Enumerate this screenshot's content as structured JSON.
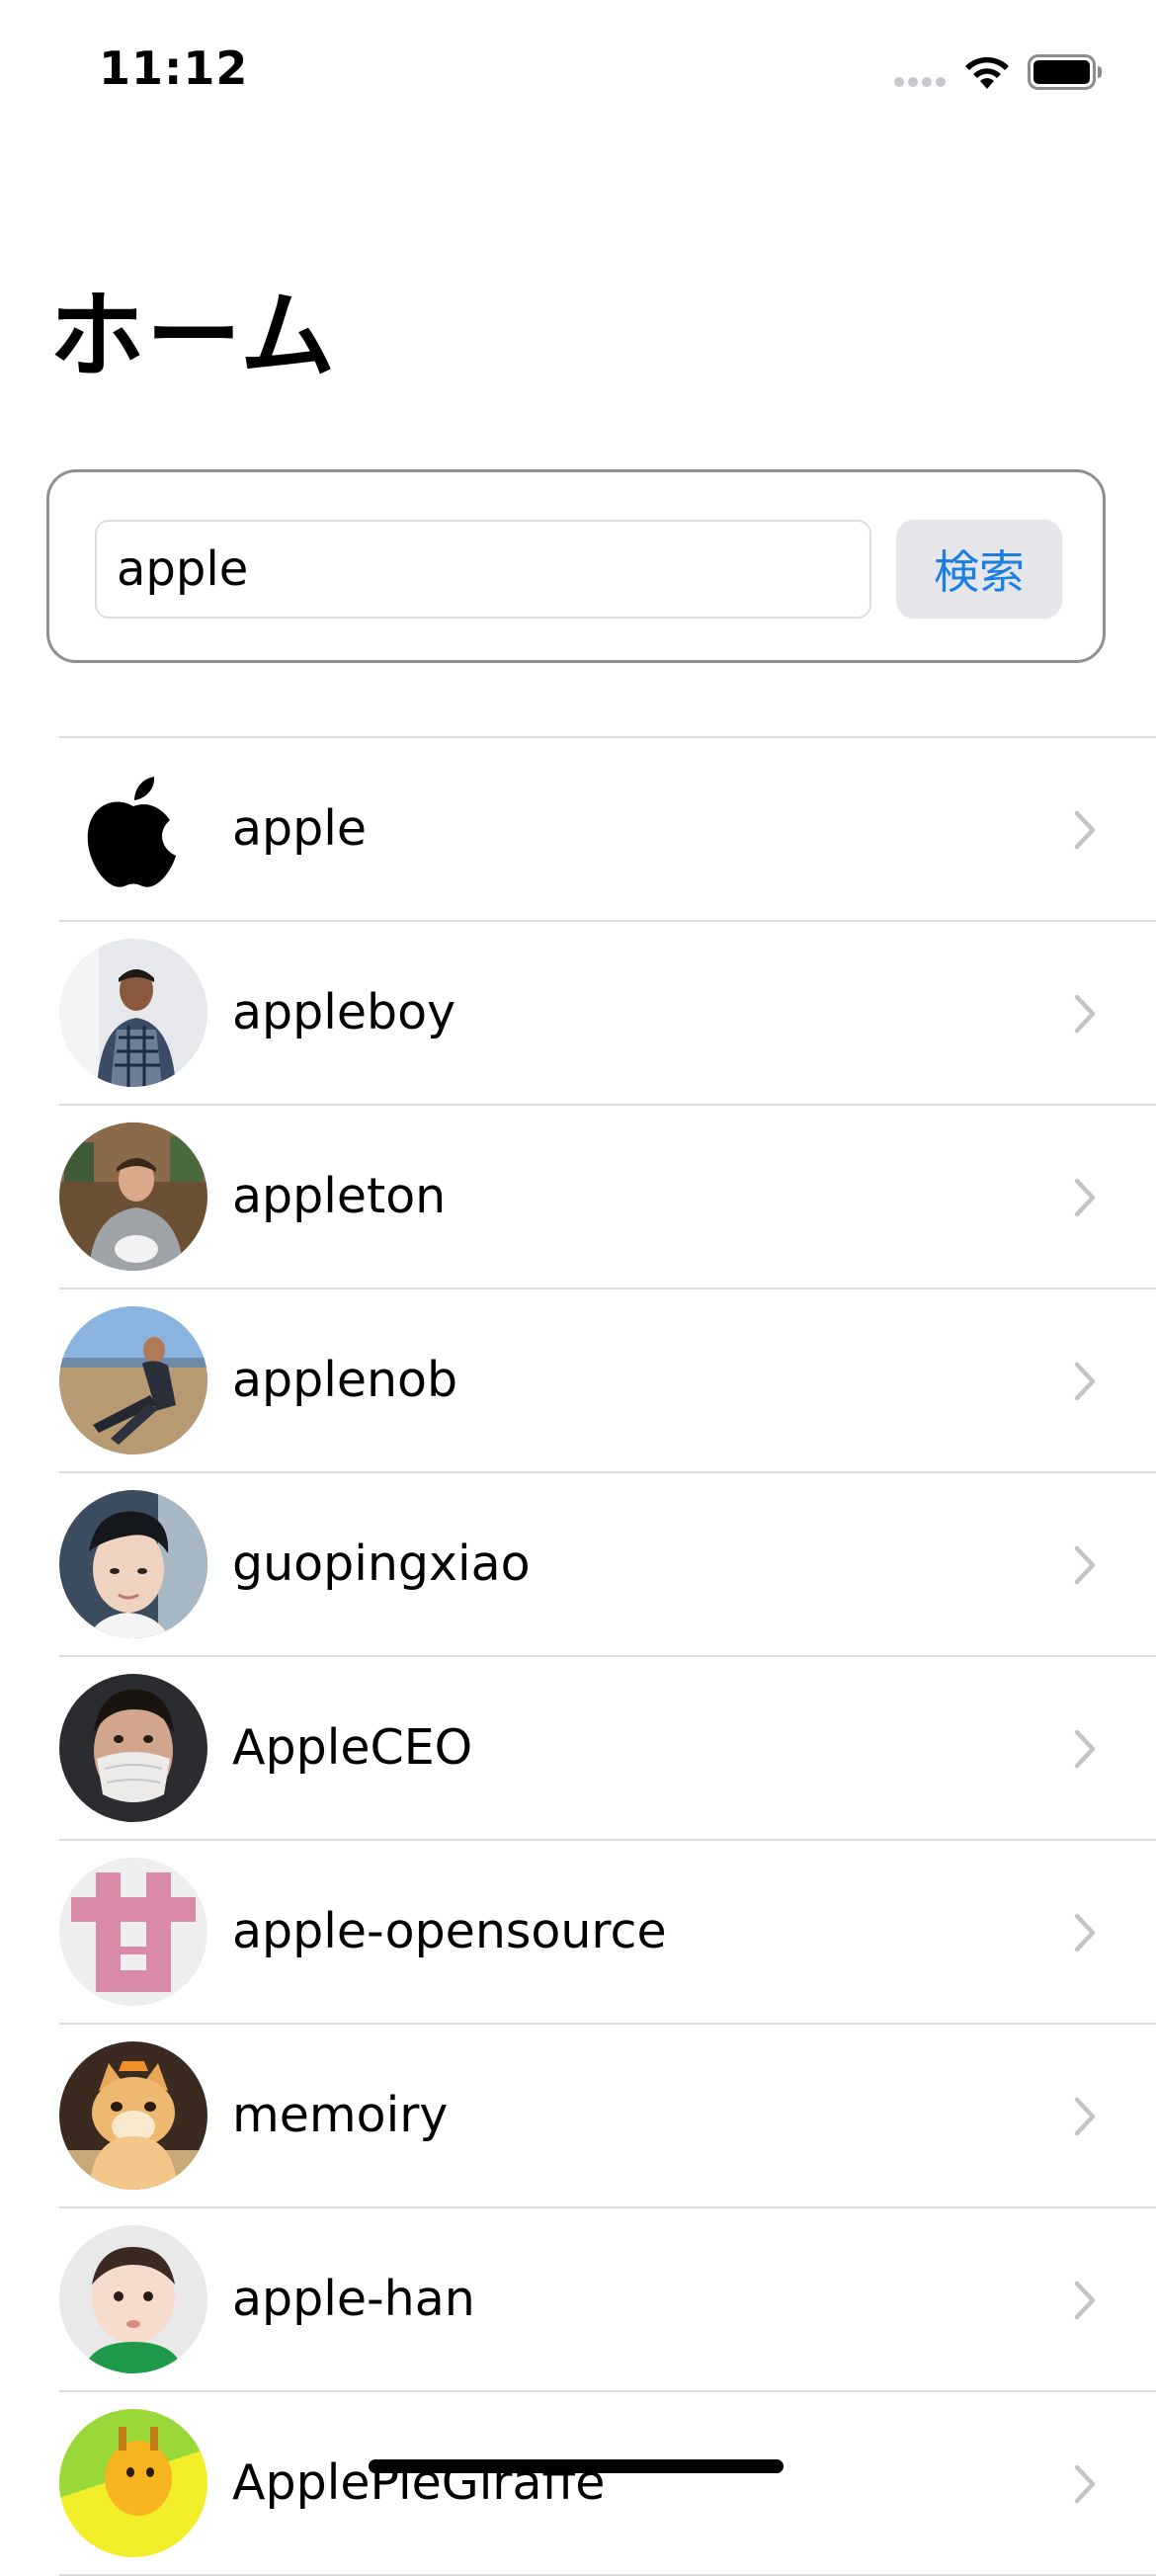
{
  "status_bar": {
    "time": "11:12"
  },
  "header": {
    "title": "ホーム"
  },
  "search": {
    "value": "apple",
    "placeholder": "",
    "button_label": "検索",
    "button_color": "#1a7fe0"
  },
  "users": [
    {
      "name": "apple",
      "avatar_icon": "apple-logo-icon"
    },
    {
      "name": "appleboy",
      "avatar_icon": "person-photo-avatar"
    },
    {
      "name": "appleton",
      "avatar_icon": "person-photo-avatar"
    },
    {
      "name": "applenob",
      "avatar_icon": "person-photo-avatar"
    },
    {
      "name": "guopingxiao",
      "avatar_icon": "person-photo-avatar"
    },
    {
      "name": "AppleCEO",
      "avatar_icon": "person-photo-avatar"
    },
    {
      "name": "apple-opensource",
      "avatar_icon": "identicon-avatar"
    },
    {
      "name": "memoiry",
      "avatar_icon": "cat-photo-avatar"
    },
    {
      "name": "apple-han",
      "avatar_icon": "baby-photo-avatar"
    },
    {
      "name": "ApplePieGiraffe",
      "avatar_icon": "giraffe-avatar"
    }
  ]
}
